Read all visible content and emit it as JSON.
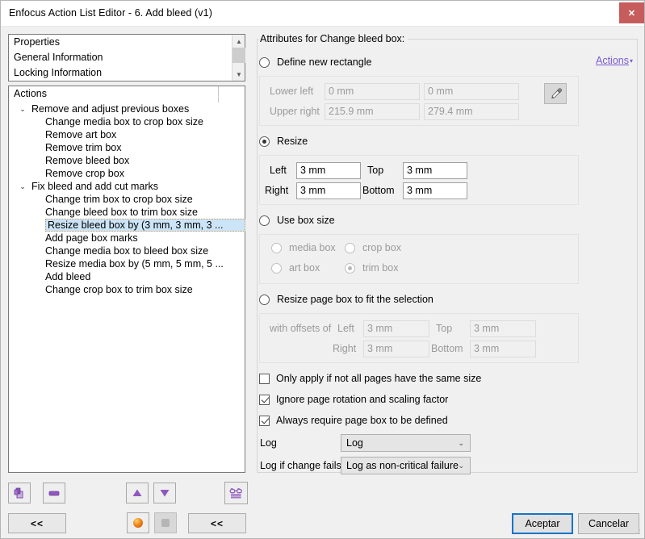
{
  "window": {
    "title": "Enfocus Action List Editor - 6. Add bleed (v1)",
    "close_label": "✕"
  },
  "properties_list": {
    "items": [
      "Properties",
      "General Information",
      "Locking Information"
    ]
  },
  "actions_tree": {
    "header": "Actions",
    "rows": [
      {
        "type": "group",
        "twisty": "⌄",
        "label": "Remove and adjust previous boxes"
      },
      {
        "type": "leaf",
        "label": "Change media box to crop box size"
      },
      {
        "type": "leaf",
        "label": "Remove art box"
      },
      {
        "type": "leaf",
        "label": "Remove trim box"
      },
      {
        "type": "leaf",
        "label": "Remove bleed box"
      },
      {
        "type": "leaf",
        "label": "Remove crop box"
      },
      {
        "type": "group",
        "twisty": "⌄",
        "label": "Fix bleed and add cut marks"
      },
      {
        "type": "leaf",
        "label": "Change trim box to crop box size"
      },
      {
        "type": "leaf",
        "label": "Change bleed box to trim box size"
      },
      {
        "type": "selected",
        "label": "Resize bleed box by (3 mm, 3 mm, 3 ..."
      },
      {
        "type": "leaf",
        "label": "Add page box marks"
      },
      {
        "type": "leaf",
        "label": "Change media box to bleed box size"
      },
      {
        "type": "leaf",
        "label": "Resize media box by (5 mm, 5 mm, 5 ..."
      },
      {
        "type": "leaf",
        "label": "Add bleed"
      },
      {
        "type": "leaf",
        "label": "Change crop box to trim box size"
      }
    ]
  },
  "attributes": {
    "legend": "Attributes for Change bleed box:",
    "actions_link": "Actions",
    "actions_caret": "▾",
    "define_rect": {
      "radio_label": "Define new rectangle",
      "checked": false,
      "lower_left_label": "Lower left",
      "lower_left_x": "0 mm",
      "lower_left_y": "0 mm",
      "upper_right_label": "Upper right",
      "upper_right_x": "215.9 mm",
      "upper_right_y": "279.4 mm",
      "eyedropper_icon": "eyedropper-icon"
    },
    "resize": {
      "radio_label": "Resize",
      "checked": true,
      "left_label": "Left",
      "left_value": "3 mm",
      "top_label": "Top",
      "top_value": "3 mm",
      "right_label": "Right",
      "right_value": "3 mm",
      "bottom_label": "Bottom",
      "bottom_value": "3 mm"
    },
    "use_box_size": {
      "radio_label": "Use box size",
      "checked": false,
      "options": [
        {
          "label": "media box",
          "checked": false
        },
        {
          "label": "crop box",
          "checked": false
        },
        {
          "label": "art box",
          "checked": false
        },
        {
          "label": "trim box",
          "checked": true
        }
      ]
    },
    "resize_page_box": {
      "radio_label": "Resize page box to fit the selection",
      "checked": false,
      "offsets_label": "with offsets of",
      "left_label": "Left",
      "left_value": "3 mm",
      "top_label": "Top",
      "top_value": "3 mm",
      "right_label": "Right",
      "right_value": "3 mm",
      "bottom_label": "Bottom",
      "bottom_value": "3 mm"
    },
    "checkboxes": [
      {
        "label": "Only apply if not all pages have the same size",
        "checked": false
      },
      {
        "label": "Ignore page rotation and scaling factor",
        "checked": true
      },
      {
        "label": "Always require page box to be defined",
        "checked": true
      }
    ],
    "log": {
      "label": "Log",
      "value": "Log",
      "chevron": "⌄"
    },
    "log_fail": {
      "label": "Log if change fails",
      "value": "Log as non-critical failure",
      "chevron": "⌄"
    }
  },
  "toolbar": {
    "add_icon": "add-action-icon",
    "remove_icon": "remove-action-icon",
    "move_up_icon": "move-up-icon",
    "move_down_icon": "move-down-icon",
    "preview_icon": "glasses-preview-icon",
    "collapse_left_label": "<<",
    "collapse_right_label": "<<",
    "enabled_icon": "orange-sphere-icon",
    "disabled_icon": "grey-square-icon"
  },
  "footer": {
    "ok_label": "Aceptar",
    "cancel_label": "Cancelar"
  },
  "colors": {
    "accent_purple": "#8050b0",
    "link_purple": "#7a5bd0",
    "selection_blue": "#cce4f7",
    "focus_blue": "#1474c9",
    "close_red": "#c75c5c",
    "orange": "#f08a20"
  }
}
